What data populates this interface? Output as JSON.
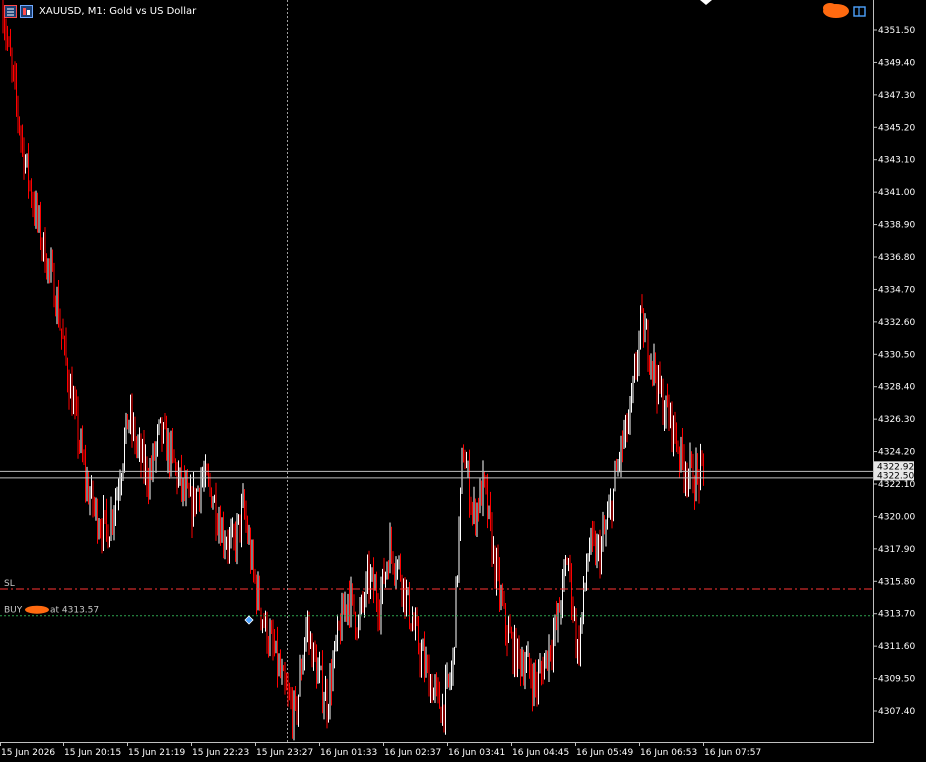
{
  "window": {
    "title": "XAUUSD, M1:  Gold vs US Dollar",
    "symbol": "XAUUSD",
    "timeframe": "M1"
  },
  "toolbar": {
    "icons": [
      "chart-menu-icon",
      "chart-grid-icon"
    ],
    "top_right_icons": [
      "trade-level-drop-icon",
      "signals-icon"
    ]
  },
  "colors": {
    "background": "#000000",
    "bar_down": "#ff0000",
    "bar_up": "#ffffff",
    "bid_ask_line": "#c0c0c0",
    "sl_line": "#ff3333",
    "buy_line": "#2ea44f",
    "crosshair": "#a0a0a0"
  },
  "price_axis": {
    "labels": [
      "4351.50",
      "4349.40",
      "4347.30",
      "4345.20",
      "4343.10",
      "4341.00",
      "4338.90",
      "4336.80",
      "4334.70",
      "4332.60",
      "4330.50",
      "4328.40",
      "4326.30",
      "4324.20",
      "4322.10",
      "4320.00",
      "4317.90",
      "4315.80",
      "4313.70",
      "4311.60",
      "4309.50",
      "4307.40"
    ],
    "current_price_labels": [
      "4322.92",
      "4322.50"
    ]
  },
  "time_axis": {
    "labels": [
      "15 Jun 2026",
      "15 Jun 20:15",
      "15 Jun 21:19",
      "15 Jun 22:23",
      "15 Jun 23:27",
      "16 Jun 01:33",
      "16 Jun 02:37",
      "16 Jun 03:41",
      "16 Jun 04:45",
      "16 Jun 05:49",
      "16 Jun 06:53",
      "16 Jun 07:57"
    ]
  },
  "levels": {
    "sl": {
      "label": "SL",
      "price": 4315.3
    },
    "buy": {
      "label": "BUY",
      "suffix": "at 4313.57",
      "price": 4313.57
    },
    "ask": 4322.92,
    "bid": 4322.5
  },
  "chart_data": {
    "type": "line",
    "title": "XAUUSD, M1:  Gold vs US Dollar",
    "xlabel": "",
    "ylabel": "",
    "ylim": [
      4306.0,
      4353.0
    ],
    "grid": false,
    "x_start": "15 Jun 2026",
    "x_end": "16 Jun 07:57",
    "anchor_prices": [
      4352.8,
      4348.0,
      4343.5,
      4340.0,
      4337.0,
      4334.5,
      4330.0,
      4326.0,
      4322.0,
      4320.0,
      4319.0,
      4322.0,
      4326.5,
      4324.0,
      4322.5,
      4325.5,
      4324.0,
      4322.0,
      4320.5,
      4322.5,
      4321.5,
      4319.0,
      4318.0,
      4320.5,
      4316.0,
      4313.0,
      4311.0,
      4308.5,
      4307.0,
      4313.0,
      4310.0,
      4308.0,
      4312.0,
      4315.0,
      4313.0,
      4316.0,
      4314.5,
      4318.0,
      4316.5,
      4313.5,
      4311.0,
      4309.0,
      4307.5,
      4310.0,
      4324.5,
      4320.0,
      4322.0,
      4317.0,
      4313.0,
      4311.0,
      4310.5,
      4309.0,
      4311.0,
      4313.0,
      4317.5,
      4311.0,
      4318.0,
      4317.5,
      4320.0,
      4324.0,
      4326.5,
      4332.5,
      4330.5,
      4327.5,
      4326.0,
      4323.5,
      4322.5,
      4322.7
    ]
  }
}
